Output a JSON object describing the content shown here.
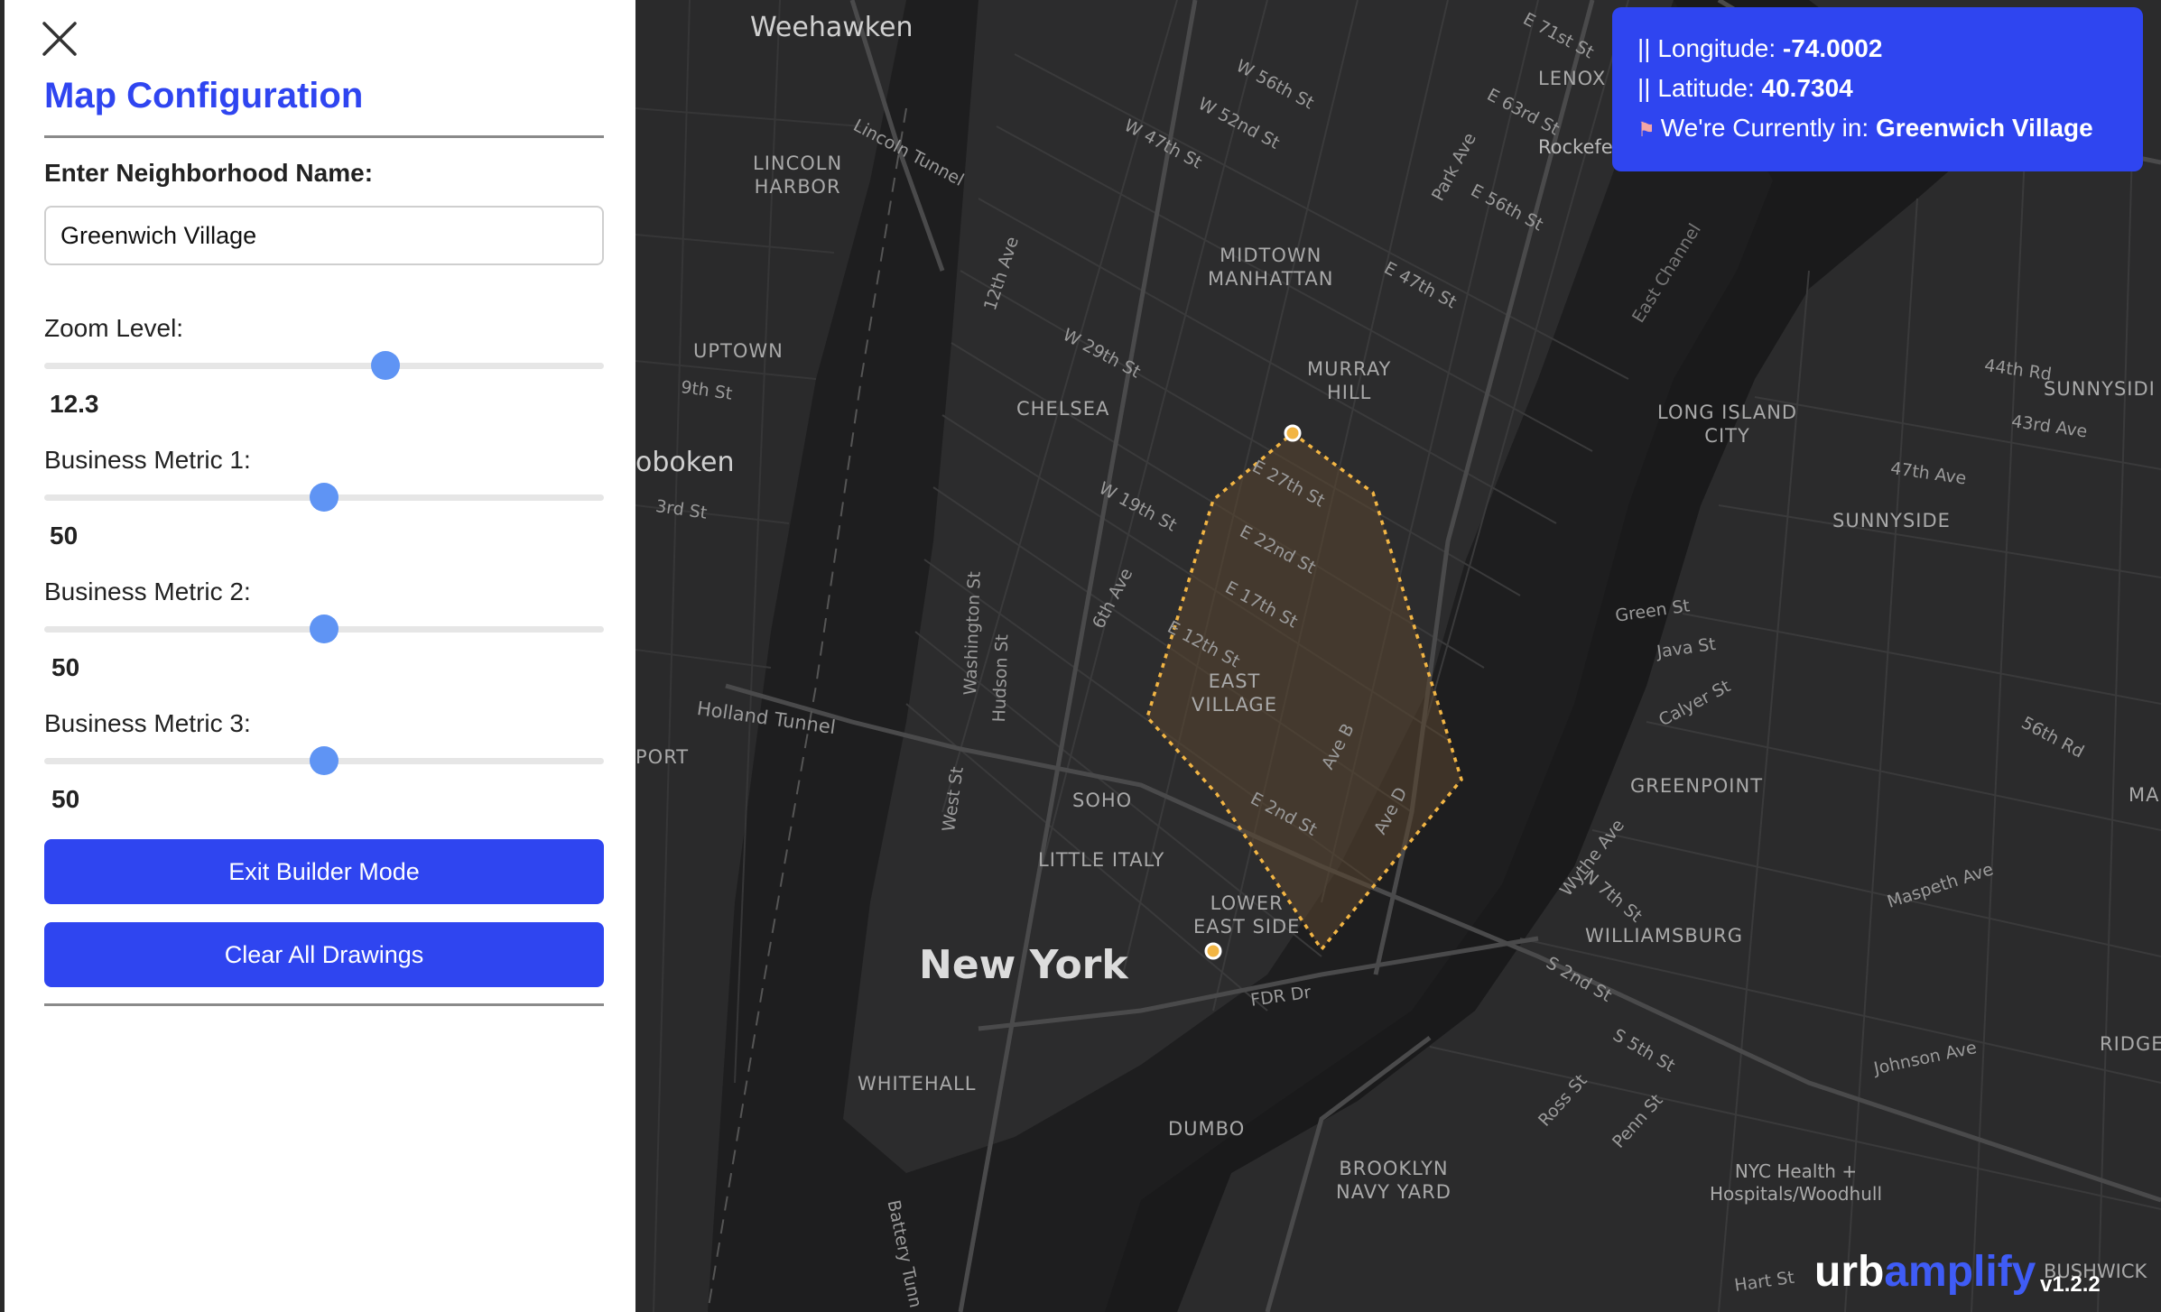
{
  "panel": {
    "title": "Map Configuration",
    "neighborhood_label": "Enter Neighborhood Name:",
    "neighborhood_value": "Greenwich Village",
    "zoom": {
      "label": "Zoom Level:",
      "value": "12.3",
      "fraction": 0.61
    },
    "metric1": {
      "label": "Business Metric 1:",
      "value": "50",
      "fraction": 0.5
    },
    "metric2": {
      "label": "Business Metric 2:",
      "value": "50",
      "fraction": 0.5
    },
    "metric3": {
      "label": "Business Metric 3:",
      "value": "50",
      "fraction": 0.5
    },
    "exit_button": "Exit Builder Mode",
    "clear_button": "Clear All Drawings"
  },
  "info": {
    "longitude_label": "|| Longitude: ",
    "longitude_value": "-74.0002",
    "latitude_label": "|| Latitude: ",
    "latitude_value": "40.7304",
    "location_label": "We're Currently in: ",
    "location_value": "Greenwich Village"
  },
  "brand": {
    "urb": "urb",
    "amp": "amplify",
    "version": "v1.2.2"
  },
  "map": {
    "labels": {
      "weehawken": "Weehawken",
      "lincoln_harbor": "LINCOLN\nHARBOR",
      "lincoln_tunnel": "Lincoln Tunnel",
      "midtown": "MIDTOWN\nMANHATTAN",
      "murray_hill": "MURRAY\nHILL",
      "lenox": "LENOX",
      "rockefeller": "Rockefel",
      "uptown": "UPTOWN",
      "chelsea": "CHELSEA",
      "hoboken": "oboken",
      "long_island_city": "LONG ISLAND\nCITY",
      "sunnyside": "SUNNYSIDE",
      "sunnyside_edge": "SUNNYSIDI",
      "east_village": "EAST\nVILLAGE",
      "soho": "SOHO",
      "little_italy": "LITTLE ITALY",
      "lower_east_side": "LOWER\nEAST SIDE",
      "new_york": "New York",
      "greenpoint": "GREENPOINT",
      "williamsburg": "WILLIAMSBURG",
      "whitehall": "WHITEHALL",
      "dumbo": "DUMBO",
      "brooklyn_navy_yard": "BROOKLYN\nNAVY YARD",
      "nyc_health": "NYC Health +\nHospitals/Woodhull",
      "holland_tunnel": "Holland Tunnel",
      "port": "PORT",
      "fdr_dr": "FDR Dr",
      "bushwick": "BUSHWICK",
      "ridge": "RIDGE",
      "ma": "MA",
      "twelfth_ave": "12th Ave",
      "w29": "W 29th St",
      "w19": "W 19th St",
      "e27": "E 27th St",
      "e22": "E 22nd St",
      "e17": "E 17th St",
      "e12": "E 12th St",
      "e2": "E 2nd St",
      "sixth_ave": "6th Ave",
      "ave_b": "Ave B",
      "ave_d": "Ave D",
      "washington": "Washington St",
      "hudson": "Hudson St",
      "west_st": "West St",
      "east_channel": "East Channel",
      "green_st": "Green St",
      "java_st": "Java St",
      "calyer_st": "Calyer St",
      "park_ave": "Park Ave",
      "johnson_ave": "Johnson Ave",
      "maspeth_ave": "Maspeth Ave",
      "s5": "S 5th St",
      "s2": "S 2nd St",
      "n7": "N 7th St",
      "wythe": "Wythe Ave",
      "hart_st": "Hart St",
      "w56": "W 56th St",
      "w52": "W 52nd St",
      "w47": "W 47th St",
      "e47": "E 47th St",
      "e56": "E 56th St",
      "e63": "E 63rd St",
      "e71": "E 71st St",
      "ave44": "44th Rd",
      "ave43": "43rd Ave",
      "ave47": "47th Ave",
      "rd56": "56th Rd",
      "third_st": "3rd St",
      "ninth_st": "9th St",
      "battery": "Battery Tunn",
      "ross": "Ross St",
      "penn": "Penn St"
    }
  },
  "colors": {
    "accent": "#2f45f0",
    "slider_thumb": "#5f94f4",
    "polygon_stroke": "#f2b544",
    "polygon_fill": "#5a4630"
  }
}
